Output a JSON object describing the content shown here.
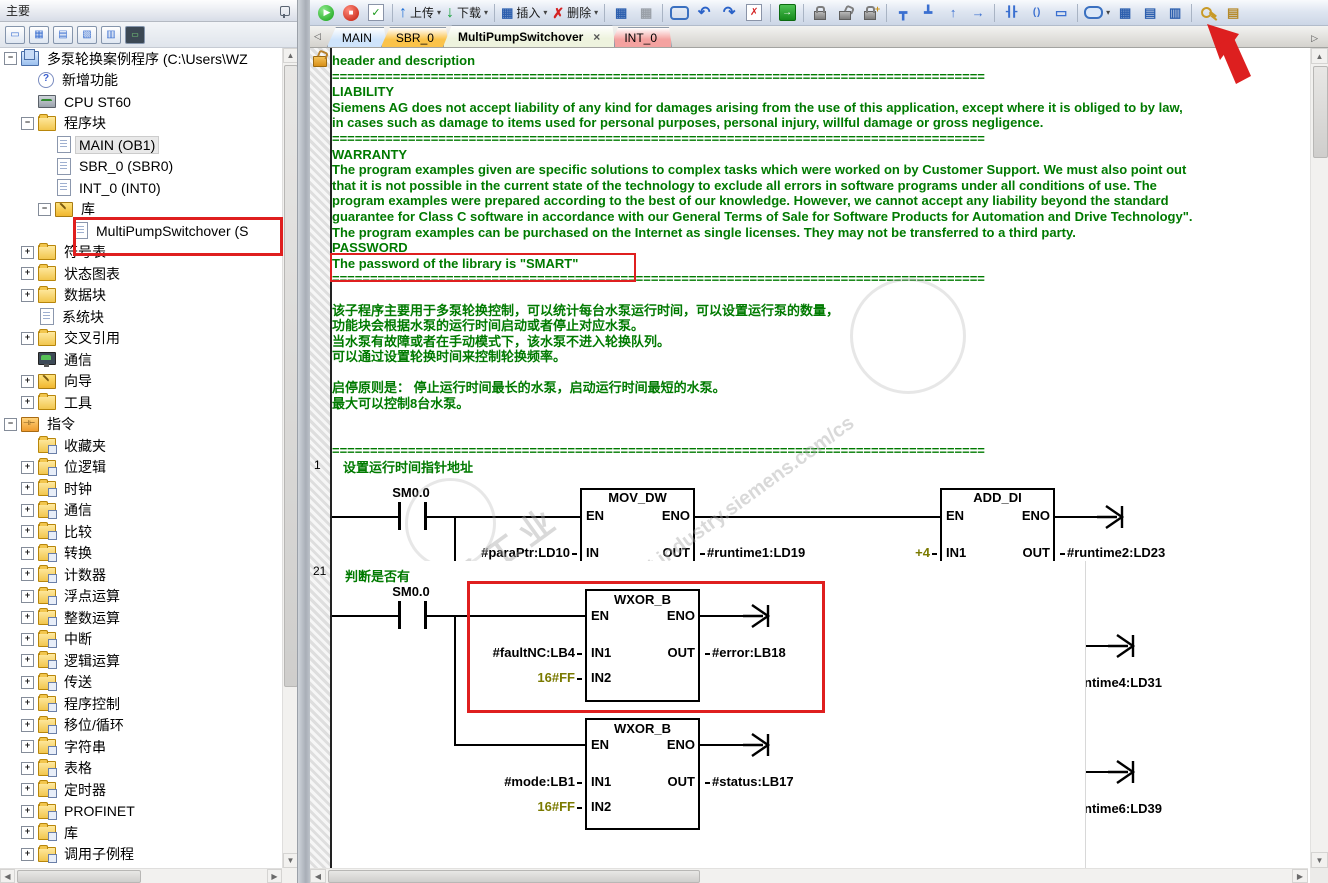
{
  "left_panel": {
    "title": "主要",
    "view_icons": [
      "program-block",
      "symbol-table",
      "status-chart",
      "data-block",
      "cross-reference",
      "communication"
    ],
    "tree": [
      {
        "label": "多泵轮换案例程序 (C:\\Users\\WZ",
        "level": 0,
        "expander": "minus",
        "icon": "project"
      },
      {
        "label": "新增功能",
        "level": 1,
        "expander": "none",
        "icon": "whatsnew"
      },
      {
        "label": "CPU ST60",
        "level": 1,
        "expander": "none",
        "icon": "cpu"
      },
      {
        "label": "程序块",
        "level": 1,
        "expander": "minus",
        "icon": "folder"
      },
      {
        "label": "MAIN (OB1)",
        "level": 2,
        "expander": "none",
        "icon": "page",
        "highlight": true
      },
      {
        "label": "SBR_0 (SBR0)",
        "level": 2,
        "expander": "none",
        "icon": "page"
      },
      {
        "label": "INT_0 (INT0)",
        "level": 2,
        "expander": "none",
        "icon": "page"
      },
      {
        "label": "库",
        "level": 2,
        "expander": "minus",
        "icon": "wizard"
      },
      {
        "label": "MultiPumpSwitchover (S",
        "level": 3,
        "expander": "none",
        "icon": "page"
      },
      {
        "label": "符号表",
        "level": 1,
        "expander": "plus",
        "icon": "folder"
      },
      {
        "label": "状态图表",
        "level": 1,
        "expander": "plus",
        "icon": "folder"
      },
      {
        "label": "数据块",
        "level": 1,
        "expander": "plus",
        "icon": "folder"
      },
      {
        "label": "系统块",
        "level": 1,
        "expander": "none",
        "icon": "page"
      },
      {
        "label": "交叉引用",
        "level": 1,
        "expander": "plus",
        "icon": "folder"
      },
      {
        "label": "通信",
        "level": 1,
        "expander": "none",
        "icon": "monitor"
      },
      {
        "label": "向导",
        "level": 1,
        "expander": "plus",
        "icon": "wizard"
      },
      {
        "label": "工具",
        "level": 1,
        "expander": "plus",
        "icon": "folder"
      },
      {
        "label": "指令",
        "level": 0,
        "expander": "minus",
        "icon": "instructions"
      },
      {
        "label": "收藏夹",
        "level": 1,
        "expander": "none",
        "icon": "folder-badge"
      },
      {
        "label": "位逻辑",
        "level": 1,
        "expander": "plus",
        "icon": "folder-badge"
      },
      {
        "label": "时钟",
        "level": 1,
        "expander": "plus",
        "icon": "folder-badge"
      },
      {
        "label": "通信",
        "level": 1,
        "expander": "plus",
        "icon": "folder-badge"
      },
      {
        "label": "比较",
        "level": 1,
        "expander": "plus",
        "icon": "folder-badge"
      },
      {
        "label": "转换",
        "level": 1,
        "expander": "plus",
        "icon": "folder-badge"
      },
      {
        "label": "计数器",
        "level": 1,
        "expander": "plus",
        "icon": "folder-badge"
      },
      {
        "label": "浮点运算",
        "level": 1,
        "expander": "plus",
        "icon": "folder-badge"
      },
      {
        "label": "整数运算",
        "level": 1,
        "expander": "plus",
        "icon": "folder-badge"
      },
      {
        "label": "中断",
        "level": 1,
        "expander": "plus",
        "icon": "folder-badge"
      },
      {
        "label": "逻辑运算",
        "level": 1,
        "expander": "plus",
        "icon": "folder-badge"
      },
      {
        "label": "传送",
        "level": 1,
        "expander": "plus",
        "icon": "folder-badge"
      },
      {
        "label": "程序控制",
        "level": 1,
        "expander": "plus",
        "icon": "folder-badge"
      },
      {
        "label": "移位/循环",
        "level": 1,
        "expander": "plus",
        "icon": "folder-badge"
      },
      {
        "label": "字符串",
        "level": 1,
        "expander": "plus",
        "icon": "folder-badge"
      },
      {
        "label": "表格",
        "level": 1,
        "expander": "plus",
        "icon": "folder-badge"
      },
      {
        "label": "定时器",
        "level": 1,
        "expander": "plus",
        "icon": "folder-badge"
      },
      {
        "label": "PROFINET",
        "level": 1,
        "expander": "plus",
        "icon": "folder-badge"
      },
      {
        "label": "库",
        "level": 1,
        "expander": "plus",
        "icon": "folder-badge"
      },
      {
        "label": "调用子例程",
        "level": 1,
        "expander": "plus",
        "icon": "folder-badge"
      }
    ]
  },
  "toolbar": {
    "items": [
      {
        "icon": "run"
      },
      {
        "icon": "stop"
      },
      {
        "icon": "compile"
      },
      {
        "sep": true
      },
      {
        "icon": "upload",
        "label": "上传",
        "caret": true
      },
      {
        "icon": "download",
        "label": "下载",
        "caret": true
      },
      {
        "sep": true
      },
      {
        "icon": "insert",
        "label": "插入",
        "caret": true
      },
      {
        "icon": "delete",
        "label": "删除",
        "caret": true
      },
      {
        "sep": true
      },
      {
        "icon": "segment-on"
      },
      {
        "icon": "segment-off"
      },
      {
        "sep": true
      },
      {
        "icon": "comment-box"
      },
      {
        "icon": "undo"
      },
      {
        "icon": "redo"
      },
      {
        "icon": "page-delete"
      },
      {
        "sep": true
      },
      {
        "icon": "go"
      },
      {
        "sep": true
      },
      {
        "icon": "lock"
      },
      {
        "icon": "unlock"
      },
      {
        "icon": "lock-add"
      },
      {
        "sep": true
      },
      {
        "icon": "branch-down"
      },
      {
        "icon": "branch-up"
      },
      {
        "icon": "line-up"
      },
      {
        "icon": "line-right"
      },
      {
        "sep": true
      },
      {
        "icon": "contact"
      },
      {
        "icon": "coil"
      },
      {
        "icon": "func-box"
      },
      {
        "sep": true
      },
      {
        "icon": "tag",
        "caret": true
      },
      {
        "icon": "addr-table"
      },
      {
        "icon": "table-edit"
      },
      {
        "icon": "symbol-edit"
      },
      {
        "sep": true
      },
      {
        "icon": "key"
      },
      {
        "icon": "properties"
      }
    ]
  },
  "tab_bar": {
    "tabs": [
      {
        "label": "MAIN",
        "color": "#cfe4fb",
        "active": false
      },
      {
        "label": "SBR_0",
        "color": "#fbc34a",
        "active": false
      },
      {
        "label": "MultiPumpSwitchover",
        "color": "#eef3de",
        "active": true,
        "close": "×"
      },
      {
        "label": "INT_0",
        "color": "#f4a2a0",
        "active": false
      }
    ]
  },
  "editor": {
    "separator": "======================================================================================",
    "comment_lines": [
      {
        "t": "header and description"
      },
      {
        "sep": true
      },
      {
        "t": "LIABILITY"
      },
      {
        "t": "Siemens AG does not accept liability of any kind for damages arising from the use of this application, except where it is obliged to by law,"
      },
      {
        "t": "in cases such as damage to items used for personal purposes, personal injury, willful damage or gross negligence."
      },
      {
        "sep": true
      },
      {
        "t": "WARRANTY"
      },
      {
        "t": "The program examples given are specific solutions to complex tasks which were worked on by Customer Support. We must also point out"
      },
      {
        "t": "that it is not possible in the current state of the technology to exclude all errors in software programs under all conditions of use. The"
      },
      {
        "t": "program examples were prepared according to the best of our knowledge. However, we cannot accept any liability beyond the standard"
      },
      {
        "t": "guarantee for Class C software in accordance with our General Terms of Sale for Software Products for Automation and Drive Technology\"."
      },
      {
        "t": "The program examples can be purchased on the Internet as single licenses. They may not be transferred to a third party."
      },
      {
        "t": "PASSWORD"
      },
      {
        "t": "The password of the library is \"SMART\"",
        "boxed": true
      },
      {
        "sep": true
      },
      {
        "t": ""
      },
      {
        "t": "该子程序主要用于多泵轮换控制，可以统计每台水泵运行时间，可以设置运行泵的数量，"
      },
      {
        "t": "功能块会根据水泵的运行时间启动或者停止对应水泵。"
      },
      {
        "t": "当水泵有故障或者在手动模式下，该水泵不进入轮换队列。"
      },
      {
        "t": "可以通过设置轮换时间来控制轮换频率。"
      },
      {
        "t": ""
      },
      {
        "t": "启停原则是： 停止运行时间最长的水泵，启动运行时间最短的水泵。"
      },
      {
        "t": "最大可以控制8台水泵。"
      },
      {
        "t": ""
      },
      {
        "t": ""
      },
      {
        "sep": true
      }
    ],
    "watermarks": [
      "西门子工业",
      "support.industry.siemens.com/cs"
    ],
    "network1": {
      "number": "1",
      "title": "设置运行时间指针地址",
      "contact": "SM0.0",
      "block1": {
        "title": "MOV_DW",
        "en": "EN",
        "eno": "ENO",
        "in": "IN",
        "out": "OUT",
        "in_operand": "#paraPtr:LD10",
        "out_operand": "#runtime1:LD19"
      },
      "block2": {
        "title": "ADD_DI",
        "en": "EN",
        "eno": "ENO",
        "in1": "IN1",
        "out": "OUT",
        "in1_operand": "+4",
        "out_operand": "#runtime2:LD23"
      }
    },
    "network21": {
      "number": "21",
      "title": "判断是否有",
      "contact": "SM0.0",
      "block1": {
        "title": "WXOR_B",
        "en": "EN",
        "eno": "ENO",
        "in1": "IN1",
        "in2": "IN2",
        "out": "OUT",
        "in1_operand": "#faultNC:LB4",
        "in2_operand": "16#FF",
        "out_operand": "#error:LB18"
      },
      "block2": {
        "title": "WXOR_B",
        "en": "EN",
        "eno": "ENO",
        "in1": "IN1",
        "in2": "IN2",
        "out": "OUT",
        "in1_operand": "#mode:LB1",
        "in2_operand": "16#FF",
        "out_operand": "#status:LB17"
      }
    },
    "fragments": {
      "out4": "ntime4:LD31",
      "out6": "ntime6:LD39"
    }
  }
}
